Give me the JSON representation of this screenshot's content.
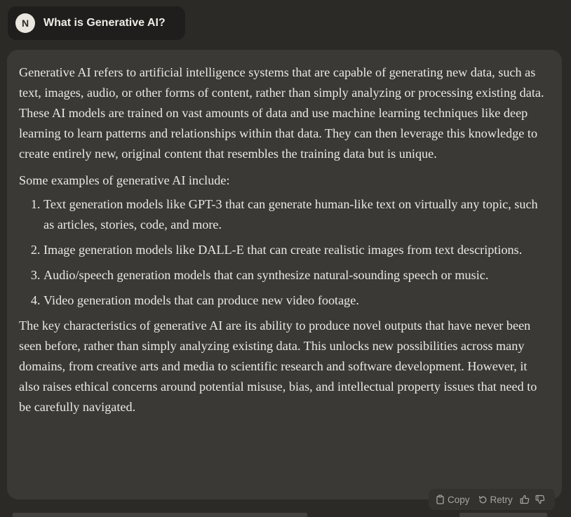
{
  "user_message": {
    "avatar_initial": "N",
    "text": "What is Generative AI?"
  },
  "response": {
    "paragraph1": "Generative AI refers to artificial intelligence systems that are capable of generating new data, such as text, images, audio, or other forms of content, rather than simply analyzing or processing existing data. These AI models are trained on vast amounts of data and use machine learning techniques like deep learning to learn patterns and relationships within that data. They can then leverage this knowledge to create entirely new, original content that resembles the training data but is unique.",
    "list_intro": "Some examples of generative AI include:",
    "examples": [
      "Text generation models like GPT-3 that can generate human-like text on virtually any topic, such as articles, stories, code, and more.",
      "Image generation models like DALL-E that can create realistic images from text descriptions.",
      "Audio/speech generation models that can synthesize natural-sounding speech or music.",
      "Video generation models that can produce new video footage."
    ],
    "paragraph2": "The key characteristics of generative AI are its ability to produce novel outputs that have never been seen before, rather than simply analyzing existing data. This unlocks new possibilities across many domains, from creative arts and media to scientific research and software development. However, it also raises ethical concerns around potential misuse, bias, and intellectual property issues that need to be carefully navigated."
  },
  "actions": {
    "copy_label": "Copy",
    "retry_label": "Retry",
    "copy_icon": "clipboard-icon",
    "retry_icon": "retry-icon",
    "thumbs_up_icon": "thumbs-up-icon",
    "thumbs_down_icon": "thumbs-down-icon"
  },
  "colors": {
    "background": "#2b2a27",
    "user_bubble": "#1f1e1c",
    "response_card": "#3a3936",
    "text": "#ebe9e2",
    "muted": "#a8a69e"
  }
}
